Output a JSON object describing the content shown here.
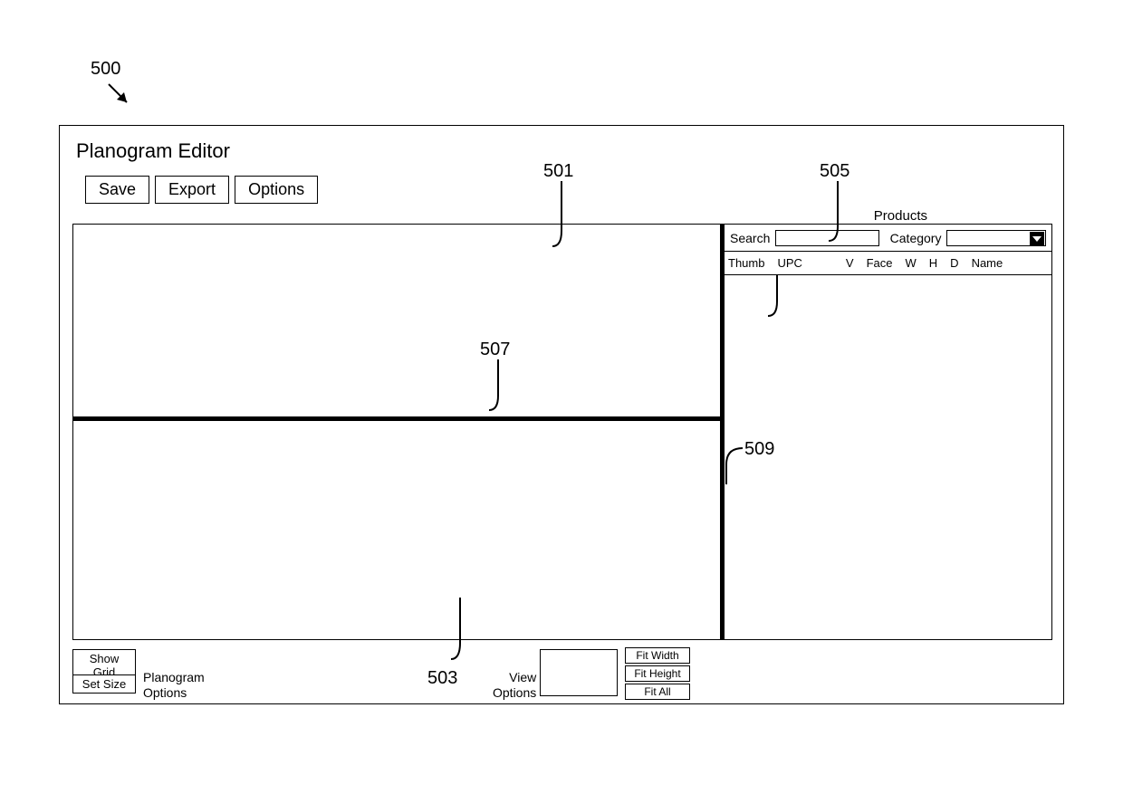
{
  "figure_ref": "500",
  "callouts": {
    "c501": "501",
    "c503": "503",
    "c505": "505",
    "c507": "507",
    "c509": "509"
  },
  "window": {
    "title": "Planogram Editor",
    "toolbar": {
      "save": "Save",
      "export": "Export",
      "options": "Options"
    }
  },
  "products": {
    "panel_label": "Products",
    "search_label": "Search",
    "search_value": "",
    "category_label": "Category",
    "category_value": "",
    "columns": {
      "thumb": "Thumb",
      "upc": "UPC",
      "v": "V",
      "face": "Face",
      "w": "W",
      "h": "H",
      "d": "D",
      "name": "Name"
    }
  },
  "bottom": {
    "show_grid": "Show Grid",
    "set_size": "Set Size",
    "planogram_options": "Planogram\nOptions",
    "view_options": "View\nOptions",
    "fit_width": "Fit Width",
    "fit_height": "Fit Height",
    "fit_all": "Fit All"
  }
}
